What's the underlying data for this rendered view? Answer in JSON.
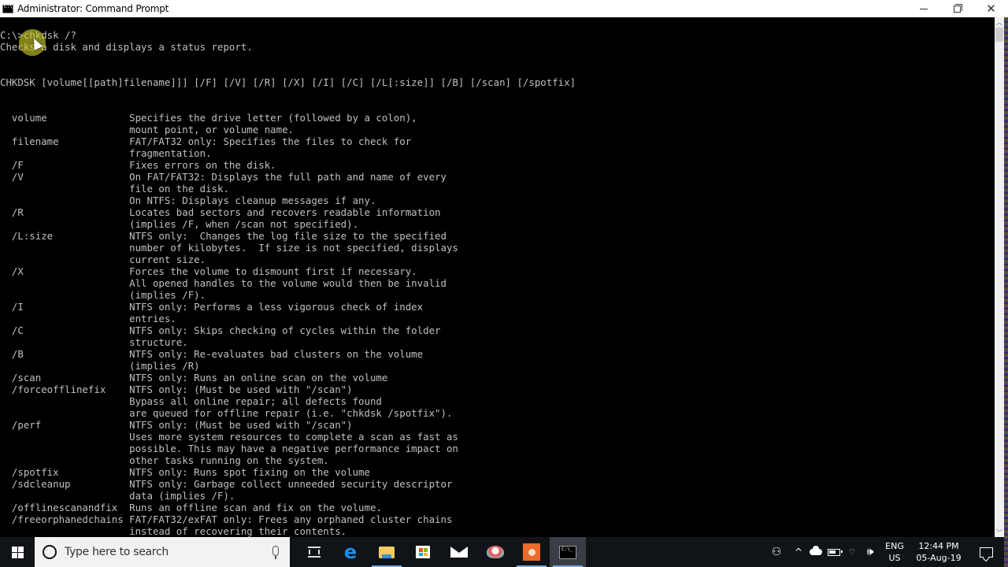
{
  "window": {
    "title": "Administrator: Command Prompt",
    "controls": {
      "minimize": "minimize",
      "maximize": "restore",
      "close": "✕"
    }
  },
  "console": {
    "prompt": "C:\\>",
    "command": "chkdsk /?",
    "lines": [
      "C:\\>chkdsk /?",
      "Checks a disk and displays a status report.",
      "",
      "",
      "CHKDSK [volume[[path]filename]]] [/F] [/V] [/R] [/X] [/I] [/C] [/L[:size]] [/B] [/scan] [/spotfix]",
      "",
      "",
      "  volume              Specifies the drive letter (followed by a colon),",
      "                      mount point, or volume name.",
      "  filename            FAT/FAT32 only: Specifies the files to check for",
      "                      fragmentation.",
      "  /F                  Fixes errors on the disk.",
      "  /V                  On FAT/FAT32: Displays the full path and name of every",
      "                      file on the disk.",
      "                      On NTFS: Displays cleanup messages if any.",
      "  /R                  Locates bad sectors and recovers readable information",
      "                      (implies /F, when /scan not specified).",
      "  /L:size             NTFS only:  Changes the log file size to the specified",
      "                      number of kilobytes.  If size is not specified, displays",
      "                      current size.",
      "  /X                  Forces the volume to dismount first if necessary.",
      "                      All opened handles to the volume would then be invalid",
      "                      (implies /F).",
      "  /I                  NTFS only: Performs a less vigorous check of index",
      "                      entries.",
      "  /C                  NTFS only: Skips checking of cycles within the folder",
      "                      structure.",
      "  /B                  NTFS only: Re-evaluates bad clusters on the volume",
      "                      (implies /R)",
      "  /scan               NTFS only: Runs an online scan on the volume",
      "  /forceofflinefix    NTFS only: (Must be used with \"/scan\")",
      "                      Bypass all online repair; all defects found",
      "                      are queued for offline repair (i.e. \"chkdsk /spotfix\").",
      "  /perf               NTFS only: (Must be used with \"/scan\")",
      "                      Uses more system resources to complete a scan as fast as",
      "                      possible. This may have a negative performance impact on",
      "                      other tasks running on the system.",
      "  /spotfix            NTFS only: Runs spot fixing on the volume",
      "  /sdcleanup          NTFS only: Garbage collect unneeded security descriptor",
      "                      data (implies /F).",
      "  /offlinescanandfix  Runs an offline scan and fix on the volume.",
      "  /freeorphanedchains FAT/FAT32/exFAT only: Frees any orphaned cluster chains",
      "                      instead of recovering their contents."
    ],
    "colors": {
      "background": "#000000",
      "foreground": "#c0c0c0"
    }
  },
  "scrollbar": {
    "up_arrow": "︿",
    "down_arrow": "﹀"
  },
  "taskbar": {
    "search_placeholder": "Type here to search",
    "pinned": [
      {
        "name": "task-view",
        "running": false
      },
      {
        "name": "edge",
        "glyph": "e",
        "running": false
      },
      {
        "name": "file-explorer",
        "running": true
      },
      {
        "name": "store",
        "running": false
      },
      {
        "name": "mail",
        "running": false
      },
      {
        "name": "snipping-tool",
        "running": false
      },
      {
        "name": "presenter",
        "running": true
      },
      {
        "name": "command-prompt",
        "running": true,
        "active": true
      }
    ],
    "tray": {
      "people": "⚇",
      "chevron": "^",
      "wifi": "⌔",
      "volume": "🕪",
      "language_top": "ENG",
      "language_bottom": "US",
      "time": "12:44 PM",
      "date": "05-Aug-19"
    },
    "accent": "#7aa7d8"
  }
}
